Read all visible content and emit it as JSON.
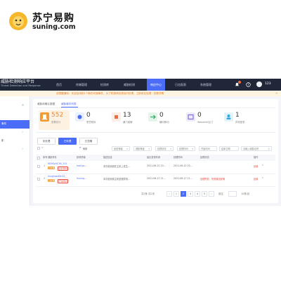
{
  "logo": {
    "cn": "苏宁易购",
    "en": "suning.com",
    "mascot_color": "#f6b72a"
  },
  "app": {
    "title_cn": "威胁检测响应平台",
    "title_en": "Threat Detection and Response",
    "nav": [
      {
        "label": "首页",
        "active": false
      },
      {
        "label": "终端管理",
        "active": false
      },
      {
        "label": "检测库",
        "active": false
      },
      {
        "label": "威胁检测",
        "active": false
      },
      {
        "label": "响应中心",
        "active": true
      },
      {
        "label": "日志报表",
        "active": false
      },
      {
        "label": "系统管理",
        "active": false
      }
    ],
    "user": {
      "name": "123",
      "notifications": "1"
    },
    "notice": "该提醒通知：安全检测到1个新的可疑事件，为了防御风险请及时处理，立即前往处理 · 查看详情",
    "sidebar": {
      "collapse_label": "«",
      "items": [
        {
          "label": "",
          "active": false
        },
        {
          "label": "事件",
          "active": true
        },
        {
          "label": "",
          "active": false,
          "has_chevron": true
        },
        {
          "label": "影",
          "active": false
        },
        {
          "label": "",
          "active": false,
          "has_chevron": true
        },
        {
          "label": "",
          "active": false
        }
      ]
    },
    "tabs": [
      {
        "label": "威胁待确认数据",
        "active": false
      },
      {
        "label": "威胁事件列表",
        "active": true
      }
    ],
    "stats": [
      {
        "value": "552",
        "label": "告警总计",
        "icon": "alarm-icon",
        "color": "#f39c34"
      },
      {
        "value": "0",
        "label": "恶意程序",
        "icon": "virus-icon",
        "color": "#4a6cf7"
      },
      {
        "value": "13",
        "label": "暴力破解",
        "icon": "crack-icon",
        "color": "#f06c3b"
      },
      {
        "value": "0",
        "label": "横向移动",
        "icon": "move-icon",
        "color": "#37b36c"
      },
      {
        "value": "0",
        "label": "Webshell后门",
        "icon": "shell-icon",
        "color": "#7b64e8"
      },
      {
        "value": "1",
        "label": "异常登录",
        "icon": "login-icon",
        "color": "#35a7e0"
      }
    ],
    "filters": {
      "buttons": [
        {
          "label": "未处理",
          "primary": false
        },
        {
          "label": "已处理",
          "primary": true
        },
        {
          "label": "已忽略",
          "primary": false
        }
      ],
      "refresh_label": "刷新",
      "selects": [
        "危险等级",
        "威胁等级",
        "处理状态",
        "处理时间",
        "开始时间",
        "结束日期"
      ],
      "search_placeholder": "请输入威胁名称"
    },
    "table": {
      "headers": [
        "序号",
        "威胁事件",
        "影响终端",
        "描述信息",
        "最近发现时间",
        "处理时间",
        "处理状态",
        "操作"
      ],
      "rows": [
        {
          "index": "1",
          "event": "HD0SyAC1N_311",
          "tag1": "已处理",
          "tag2": "高危风险",
          "host": "host-pc...",
          "desc": "本次检测到在主机上发生...",
          "found": "2021-06-22 20...",
          "handled": "2021-06-22 20...",
          "status": "",
          "action": "处置"
        },
        {
          "index": "2",
          "event": "SvcghostWin32_",
          "tag1": "已处理",
          "tag2": "严重风险",
          "host": "Suning...",
          "desc": "本次检测到主机进程异常...",
          "found": "2021-06-27 21...",
          "handled": "2021-06-27 21...",
          "status": "处理失败，失败原因说明",
          "action": "处置"
        }
      ]
    },
    "pagination": {
      "total": "共2条 共2页",
      "pages": [
        "1",
        "2",
        "3",
        "4",
        "5"
      ],
      "current": "2",
      "jump_label": "前往",
      "page_size": "10条/页"
    }
  }
}
